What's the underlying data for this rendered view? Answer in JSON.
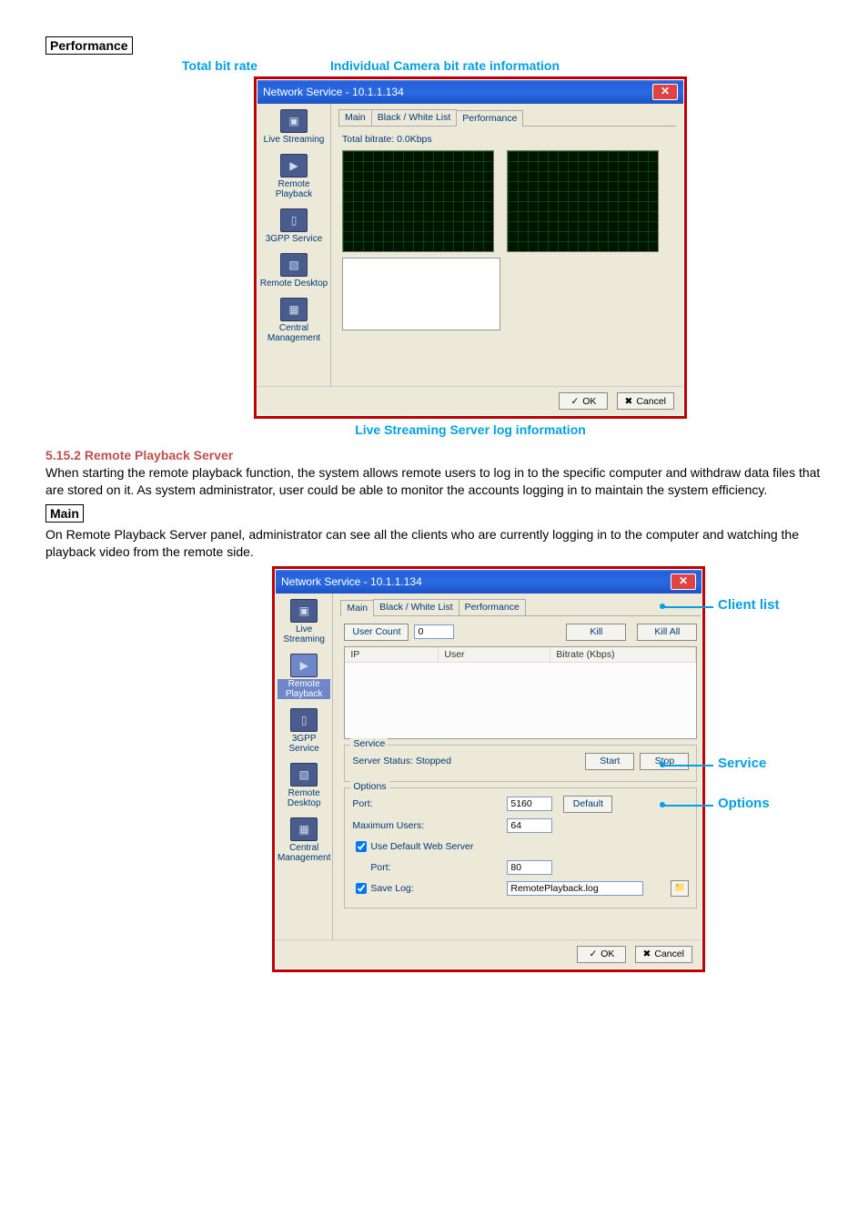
{
  "section1": {
    "label": "Performance",
    "header_left": "Total bit rate",
    "header_right": "Individual Camera bit rate information",
    "caption": "Live Streaming Server log information"
  },
  "dialog1": {
    "title": "Network Service - 10.1.1.134",
    "tabs": {
      "main": "Main",
      "bw": "Black / White List",
      "perf": "Performance"
    },
    "bitrate_label": "Total bitrate: 0.0Kbps",
    "ok": "OK",
    "cancel": "Cancel"
  },
  "sidebar": {
    "live": "Live Streaming",
    "remote_pb": "Remote Playback",
    "gpp": "3GPP Service",
    "remote_dt": "Remote Desktop",
    "central": "Central Management"
  },
  "section2": {
    "header": "5.15.2 Remote Playback Server",
    "para": "When starting the remote playback function, the system allows remote users to log in to the specific computer and withdraw data files that are stored on it. As system administrator, user could be able to monitor the accounts logging in to maintain the system efficiency."
  },
  "section3": {
    "label": "Main",
    "para": "On Remote Playback Server panel, administrator can see all the clients who are currently logging in to the computer and watching the playback video from the remote side."
  },
  "dialog2": {
    "title": "Network Service - 10.1.1.134",
    "user_count_label": "User Count",
    "user_count_value": "0",
    "kill": "Kill",
    "kill_all": "Kill All",
    "col_ip": "IP",
    "col_user": "User",
    "col_bitrate": "Bitrate (Kbps)",
    "service_title": "Service",
    "server_status": "Server Status: Stopped",
    "start": "Start",
    "stop": "Stop",
    "options_title": "Options",
    "port_label": "Port:",
    "port_value": "5160",
    "default": "Default",
    "max_users_label": "Maximum Users:",
    "max_users_value": "64",
    "use_default_ws": "Use Default Web Server",
    "ws_port_label": "Port:",
    "ws_port_value": "80",
    "save_log": "Save Log:",
    "log_file": "RemotePlayback.log",
    "ok": "OK",
    "cancel": "Cancel"
  },
  "annots": {
    "client_list": "Client list",
    "service": "Service",
    "options": "Options"
  }
}
